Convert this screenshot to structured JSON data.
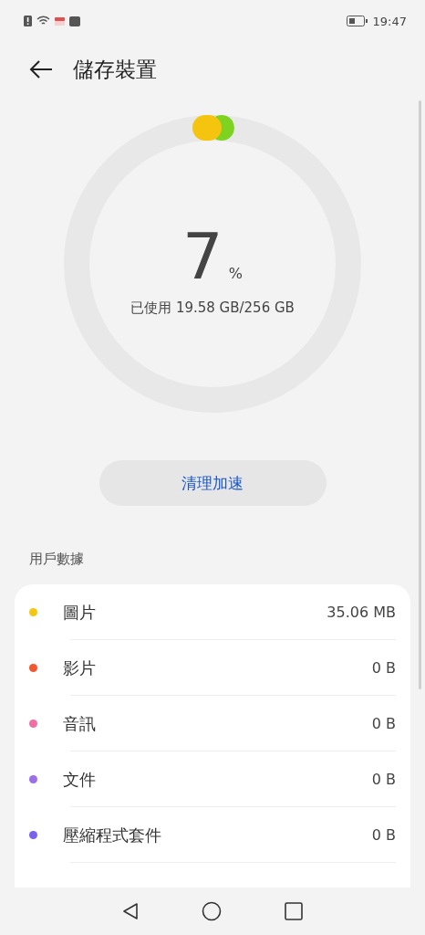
{
  "status_bar": {
    "time": "19:47"
  },
  "header": {
    "title": "儲存裝置"
  },
  "usage": {
    "percent": "7",
    "unit": "%",
    "detail": "已使用 19.58 GB/256 GB"
  },
  "clean_button": {
    "label": "清理加速"
  },
  "section": {
    "title": "用戶數據"
  },
  "items": [
    {
      "name": "圖片",
      "size": "35.06 MB",
      "color": "#f2c811"
    },
    {
      "name": "影片",
      "size": "0 B",
      "color": "#f0582e"
    },
    {
      "name": "音訊",
      "size": "0 B",
      "color": "#ee6fa3"
    },
    {
      "name": "文件",
      "size": "0 B",
      "color": "#9c6ee8"
    },
    {
      "name": "壓縮程式套件",
      "size": "0 B",
      "color": "#7a62ea"
    }
  ]
}
